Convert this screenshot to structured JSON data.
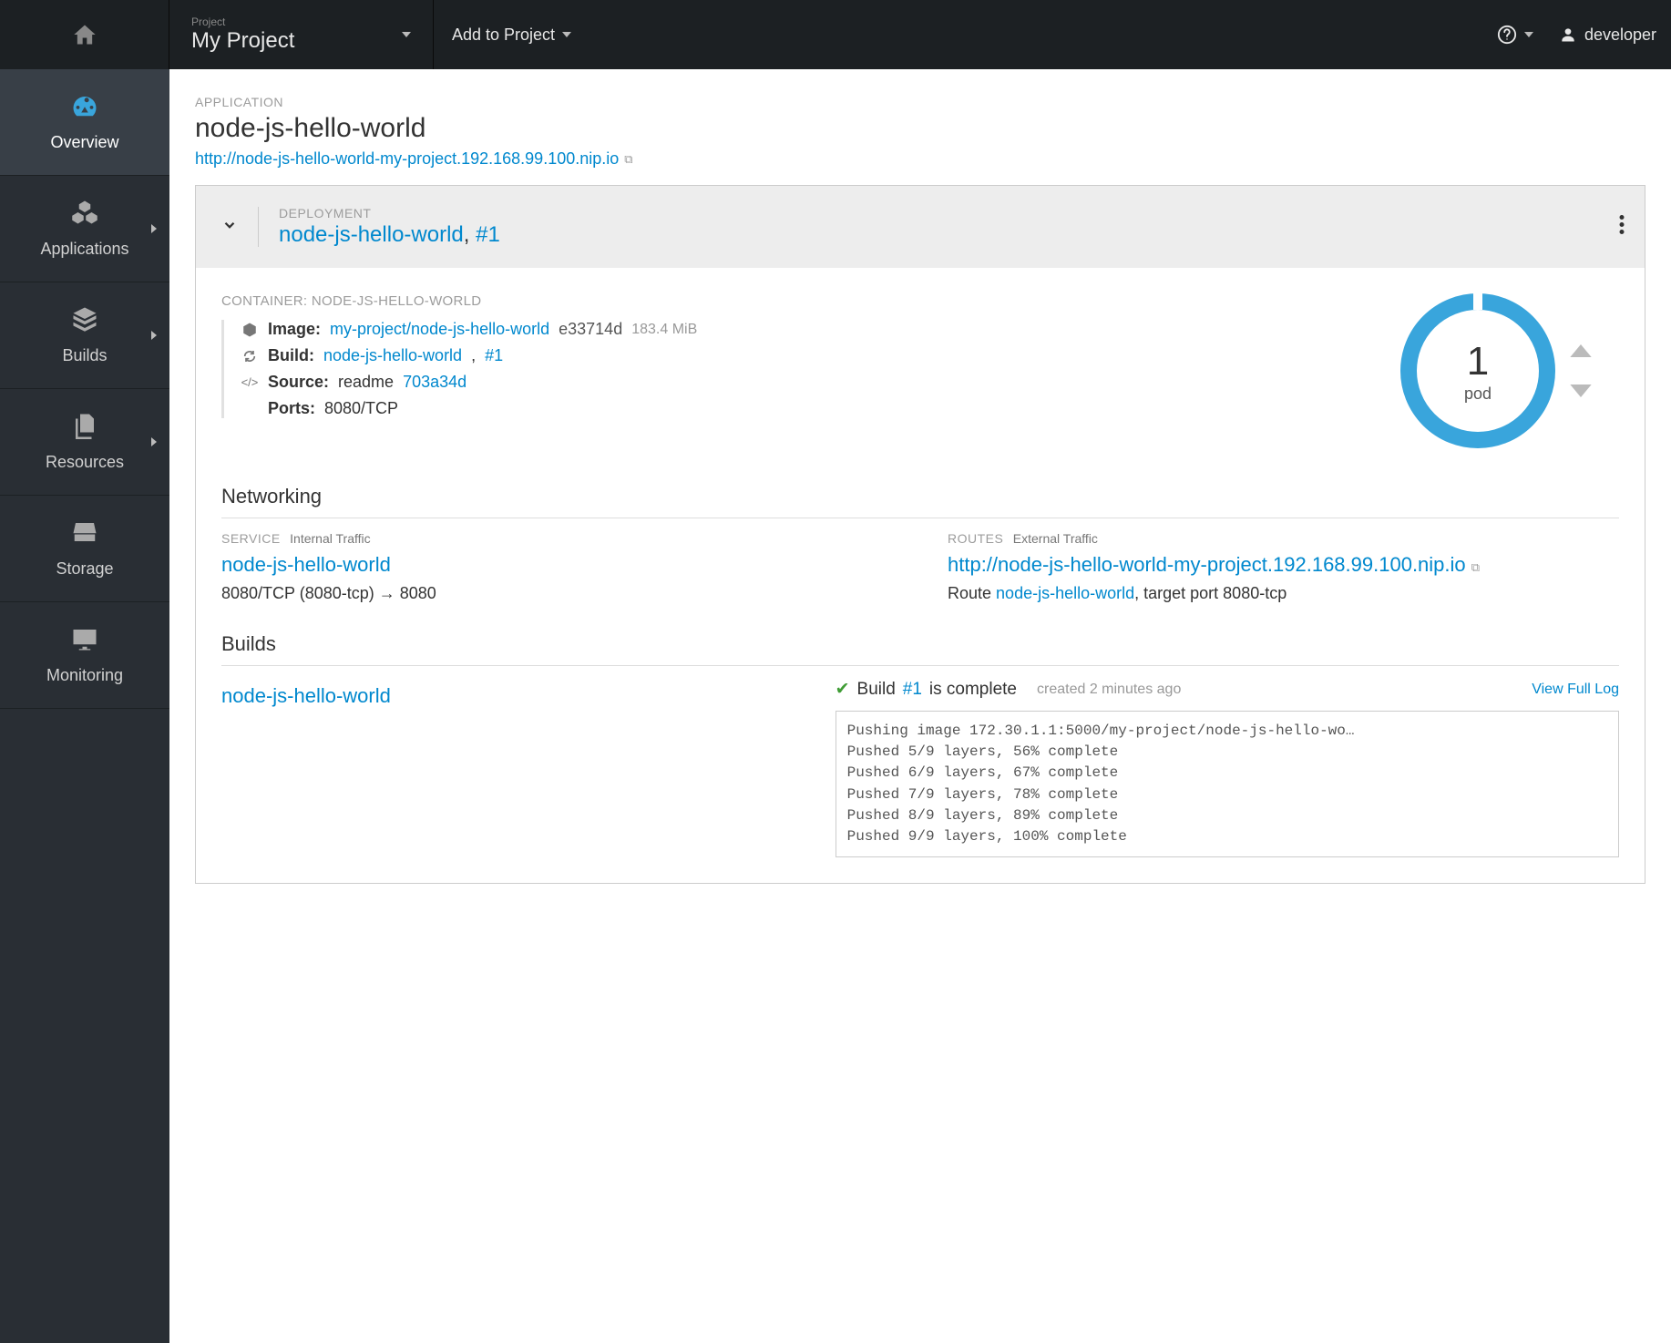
{
  "topbar": {
    "project_label": "Project",
    "project_name": "My Project",
    "add_to_project": "Add to Project",
    "username": "developer"
  },
  "sidebar": {
    "items": [
      {
        "label": "Overview",
        "expandable": false,
        "active": true
      },
      {
        "label": "Applications",
        "expandable": true,
        "active": false
      },
      {
        "label": "Builds",
        "expandable": true,
        "active": false
      },
      {
        "label": "Resources",
        "expandable": true,
        "active": false
      },
      {
        "label": "Storage",
        "expandable": false,
        "active": false
      },
      {
        "label": "Monitoring",
        "expandable": false,
        "active": false
      }
    ]
  },
  "app": {
    "label": "APPLICATION",
    "name": "node-js-hello-world",
    "url": "http://node-js-hello-world-my-project.192.168.99.100.nip.io"
  },
  "deployment": {
    "label": "DEPLOYMENT",
    "name": "node-js-hello-world",
    "number": "#1",
    "container_label": "CONTAINER: NODE-JS-HELLO-WORLD",
    "image_label": "Image:",
    "image_link": "my-project/node-js-hello-world",
    "image_hash": "e33714d",
    "image_size": "183.4 MiB",
    "build_label": "Build:",
    "build_link": "node-js-hello-world",
    "build_number": "#1",
    "source_label": "Source:",
    "source_text": "readme",
    "source_hash": "703a34d",
    "ports_label": "Ports:",
    "ports_value": "8080/TCP",
    "pod_count": "1",
    "pod_label": "pod"
  },
  "networking": {
    "title": "Networking",
    "service_heading": "SERVICE",
    "service_sub": "Internal Traffic",
    "service_name": "node-js-hello-world",
    "service_ports": "8080/TCP (8080-tcp) → 8080",
    "routes_heading": "ROUTES",
    "routes_sub": "External Traffic",
    "route_url": "http://node-js-hello-world-my-project.192.168.99.100.nip.io",
    "route_prefix": "Route ",
    "route_name": "node-js-hello-world",
    "route_suffix": ", target port 8080-tcp"
  },
  "builds": {
    "title": "Builds",
    "build_name": "node-js-hello-world",
    "status_prefix": "Build ",
    "status_link": "#1",
    "status_suffix": " is complete",
    "created": "created 2 minutes ago",
    "view_log": "View Full Log",
    "log": "Pushing image 172.30.1.1:5000/my-project/node-js-hello-wo…\nPushed 5/9 layers, 56% complete\nPushed 6/9 layers, 67% complete\nPushed 7/9 layers, 78% complete\nPushed 8/9 layers, 89% complete\nPushed 9/9 layers, 100% complete"
  }
}
